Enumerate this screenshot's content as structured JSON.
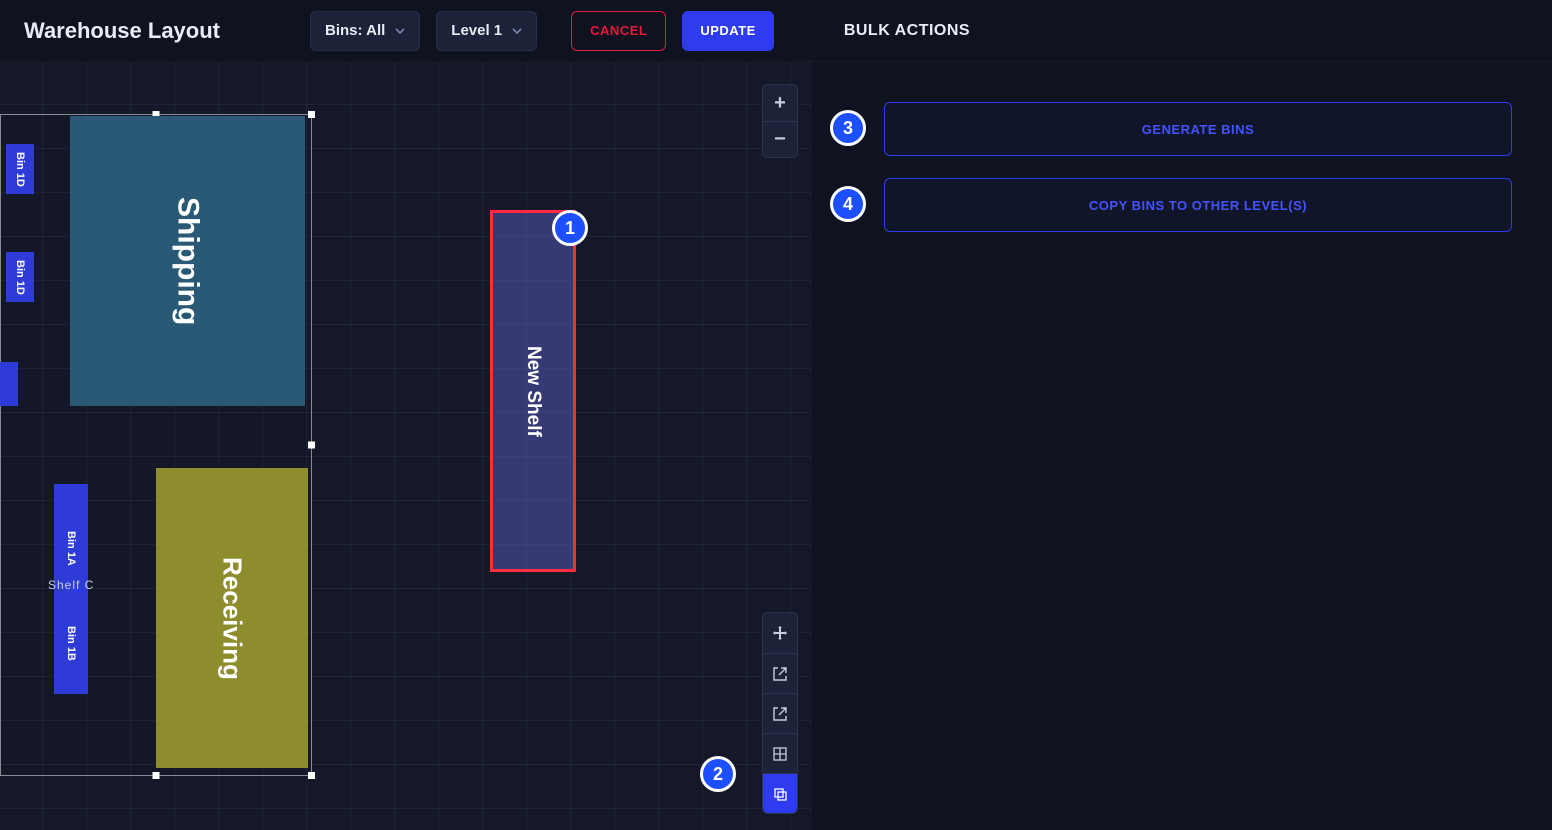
{
  "header": {
    "title": "Warehouse Layout",
    "filter_bins": "Bins: All",
    "filter_level": "Level 1",
    "cancel": "CANCEL",
    "update": "UPDATE"
  },
  "side": {
    "title": "BULK ACTIONS",
    "generate": "GENERATE BINS",
    "copy": "COPY BINS TO OTHER LEVEL(S)"
  },
  "canvas": {
    "shipping": "Shipping",
    "receiving": "Receiving",
    "newshelf": "New Shelf",
    "bin1d": "Bin 1D",
    "bin1a": "Bin 1A",
    "bin1b": "Bin 1B",
    "shelfc": "Shelf C"
  },
  "zoom": {
    "in": "+",
    "out": "−"
  },
  "callouts": {
    "c1": "1",
    "c2": "2",
    "c3": "3",
    "c4": "4"
  }
}
